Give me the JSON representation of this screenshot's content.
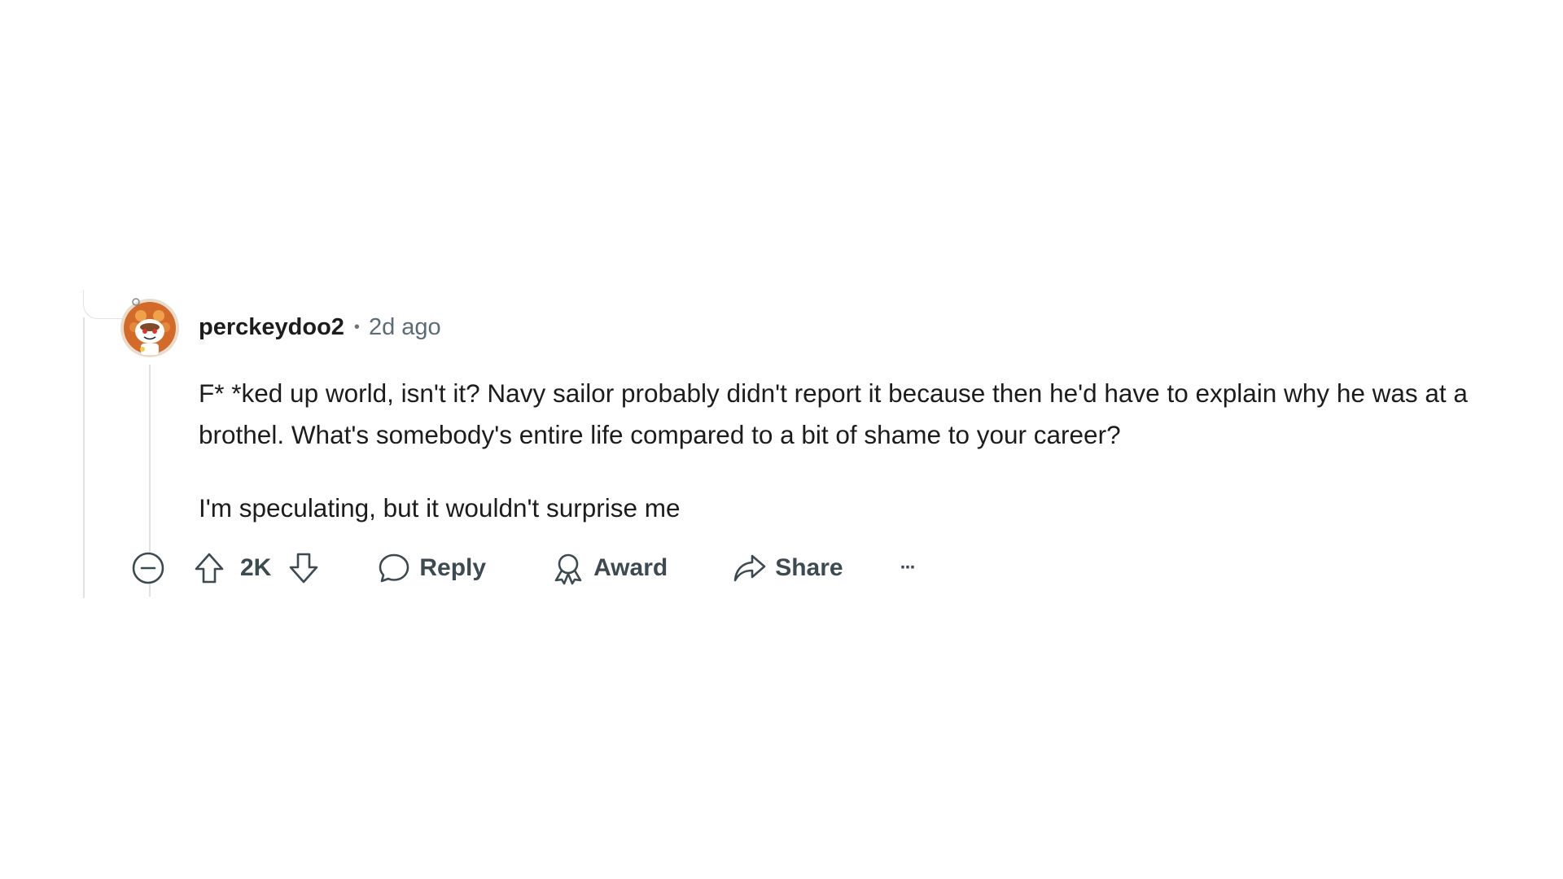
{
  "comment": {
    "username": "perckeydoo2",
    "separator": "•",
    "time_ago": "2d ago",
    "paragraphs": [
      "F* *ked up world, isn't it? Navy sailor probably didn't report it because then he'd have to explain why he was at a brothel. What's somebody's entire life compared to a bit of shame to your career?",
      "I'm speculating, but it wouldn't surprise me"
    ]
  },
  "actions": {
    "vote_count": "2K",
    "reply_label": "Reply",
    "award_label": "Award",
    "share_label": "Share",
    "more_label": "···"
  },
  "icons": {
    "collapse": "collapse-minus-icon",
    "upvote": "upvote-arrow-icon",
    "downvote": "downvote-arrow-icon",
    "reply": "speech-bubble-icon",
    "award": "award-ribbon-icon",
    "share": "share-arrow-icon",
    "more": "ellipsis-icon"
  },
  "colors": {
    "text": "#1c1c1c",
    "muted": "#5c6c74",
    "action": "#3c4a52",
    "thread_line": "#dfe3e6",
    "avatar_ring": "#e07a2c"
  }
}
